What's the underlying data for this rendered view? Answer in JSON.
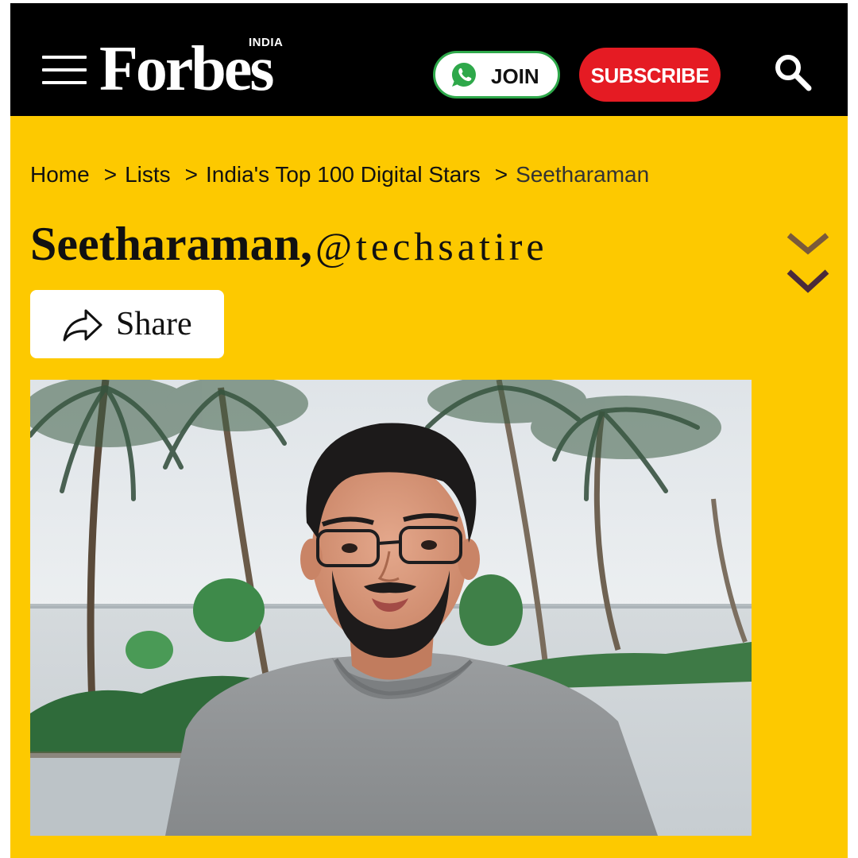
{
  "header": {
    "logo": "Forbes",
    "edition": "INDIA",
    "join_label": "JOIN",
    "subscribe_label": "SUBSCRIBE"
  },
  "breadcrumb": {
    "items": [
      "Home",
      "Lists",
      "India's Top 100 Digital Stars",
      "Seetharaman"
    ],
    "separator": ">"
  },
  "profile": {
    "name": "Seetharaman,",
    "handle": "@techsatire"
  },
  "share_label": "Share",
  "colors": {
    "page_background": "#fdc900",
    "header_background": "#000000",
    "subscribe": "#e51b23",
    "whatsapp": "#2ea84a",
    "chevron_top": "#7a5a3a",
    "chevron_bottom": "#4a2a3a"
  },
  "icons": [
    "menu-icon",
    "whatsapp-icon",
    "search-icon",
    "chevron-down-icon",
    "share-icon"
  ]
}
